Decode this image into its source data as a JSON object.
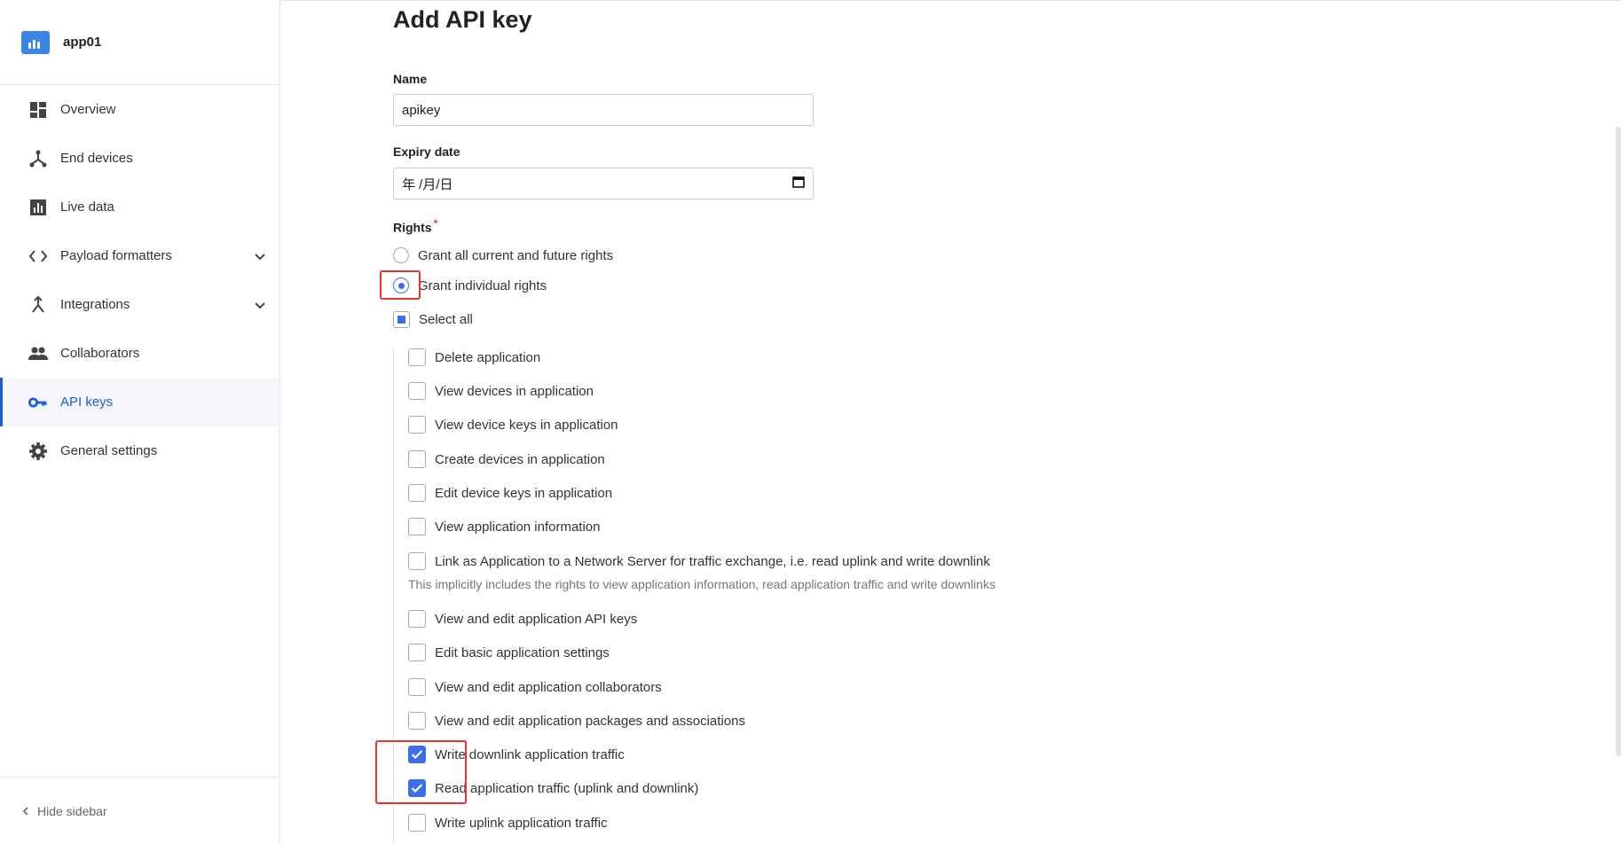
{
  "sidebar": {
    "app_name": "app01",
    "items": [
      {
        "label": "Overview",
        "icon": "dashboard-icon"
      },
      {
        "label": "End devices",
        "icon": "device-hub-icon"
      },
      {
        "label": "Live data",
        "icon": "bar-chart-icon"
      },
      {
        "label": "Payload formatters",
        "icon": "code-icon"
      },
      {
        "label": "Integrations",
        "icon": "merge-icon"
      },
      {
        "label": "Collaborators",
        "icon": "people-icon"
      },
      {
        "label": "API keys",
        "icon": "key-icon",
        "active": true
      },
      {
        "label": "General settings",
        "icon": "gear-icon"
      }
    ],
    "hide_label": "Hide sidebar"
  },
  "form": {
    "title": "Add API key",
    "name_label": "Name",
    "name_value": "apikey",
    "expiry_label": "Expiry date",
    "expiry_value": "年 /月/日",
    "rights_label": "Rights",
    "required_mark": "*",
    "rights_mode": [
      {
        "label": "Grant all current and future rights",
        "selected": false
      },
      {
        "label": "Grant individual rights",
        "selected": true
      }
    ],
    "select_all_label": "Select all",
    "rights": [
      {
        "label": "Delete application",
        "checked": false
      },
      {
        "label": "View devices in application",
        "checked": false
      },
      {
        "label": "View device keys in application",
        "checked": false
      },
      {
        "label": "Create devices in application",
        "checked": false
      },
      {
        "label": "Edit device keys in application",
        "checked": false
      },
      {
        "label": "View application information",
        "checked": false
      },
      {
        "label": "Link as Application to a Network Server for traffic exchange, i.e. read uplink and write downlink",
        "checked": false
      },
      {
        "label": "View and edit application API keys",
        "checked": false
      },
      {
        "label": "Edit basic application settings",
        "checked": false
      },
      {
        "label": "View and edit application collaborators",
        "checked": false
      },
      {
        "label": "View and edit application packages and associations",
        "checked": false
      },
      {
        "label": "Write downlink application traffic",
        "checked": true
      },
      {
        "label": "Read application traffic (uplink and downlink)",
        "checked": true
      },
      {
        "label": "Write uplink application traffic",
        "checked": false
      }
    ],
    "link_hint": "This implicitly includes the rights to view application information, read application traffic and write downlinks"
  },
  "colors": {
    "accent": "#3b6ee8",
    "active_nav": "#1a5fd6",
    "annotation": "#e8332b"
  }
}
